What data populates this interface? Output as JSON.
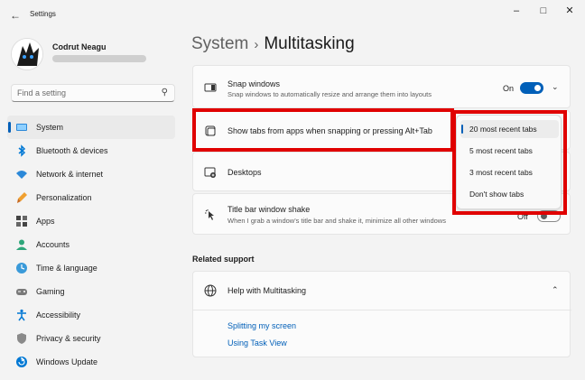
{
  "window": {
    "title": "Settings",
    "minimize_glyph": "–",
    "maximize_glyph": "□",
    "close_glyph": "✕",
    "back_glyph": "←"
  },
  "user": {
    "name": "Codrut Neagu"
  },
  "search": {
    "placeholder": "Find a setting",
    "icon_glyph": "⚲"
  },
  "sidebar": {
    "items": [
      {
        "label": "System",
        "icon": "system-icon",
        "active": true
      },
      {
        "label": "Bluetooth & devices",
        "icon": "bluetooth-icon"
      },
      {
        "label": "Network & internet",
        "icon": "wifi-icon"
      },
      {
        "label": "Personalization",
        "icon": "brush-icon"
      },
      {
        "label": "Apps",
        "icon": "apps-icon"
      },
      {
        "label": "Accounts",
        "icon": "account-icon"
      },
      {
        "label": "Time & language",
        "icon": "globe-clock-icon"
      },
      {
        "label": "Gaming",
        "icon": "gamepad-icon"
      },
      {
        "label": "Accessibility",
        "icon": "accessibility-icon"
      },
      {
        "label": "Privacy & security",
        "icon": "shield-icon"
      },
      {
        "label": "Windows Update",
        "icon": "update-icon"
      }
    ]
  },
  "header": {
    "crumb": "System",
    "separator": "›",
    "title": "Multitasking"
  },
  "settings": {
    "snap": {
      "title": "Snap windows",
      "description": "Snap windows to automatically resize and arrange them into layouts",
      "toggle_label": "On",
      "toggle_on": true
    },
    "tabs": {
      "title": "Show tabs from apps when snapping or pressing Alt+Tab"
    },
    "desktops": {
      "title": "Desktops"
    },
    "shake": {
      "title": "Title bar window shake",
      "description": "When I grab a window's title bar and shake it, minimize all other windows",
      "toggle_label": "Off",
      "toggle_on": false
    }
  },
  "dropdown": {
    "options": [
      "20 most recent tabs",
      "5 most recent tabs",
      "3 most recent tabs",
      "Don't show tabs"
    ],
    "selected": "20 most recent tabs"
  },
  "related_support": {
    "title": "Related support",
    "help_title": "Help with Multitasking",
    "links": [
      "Splitting my screen",
      "Using Task View"
    ]
  },
  "colors": {
    "accent": "#005fb8",
    "highlight": "#e00000"
  }
}
